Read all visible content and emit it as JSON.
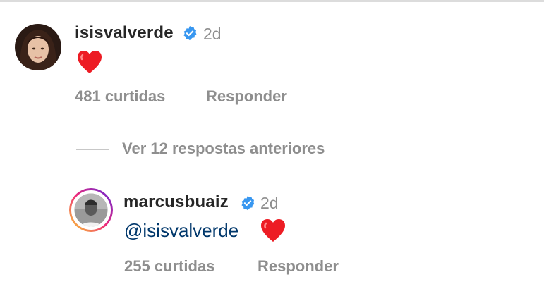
{
  "comment": {
    "username": "isisvalverde",
    "age": "2d",
    "likes": "481 curtidas",
    "reply_label": "Responder",
    "emoji_icon": "red-heart-icon"
  },
  "view_replies": {
    "label": "Ver 12 respostas anteriores"
  },
  "reply": {
    "username": "marcusbuaiz",
    "age": "2d",
    "mention": "@isisvalverde",
    "likes": "255 curtidas",
    "reply_label": "Responder",
    "emoji_icon": "red-heart-icon"
  },
  "colors": {
    "verified": "#3897f0",
    "heart": "#ed1c24",
    "mention": "#00376b",
    "muted": "#8e8e8e"
  }
}
